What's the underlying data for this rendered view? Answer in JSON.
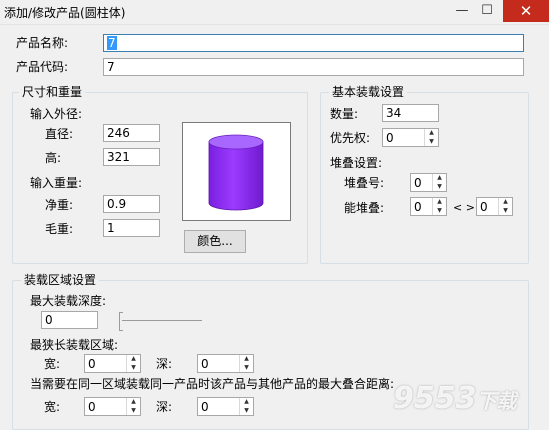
{
  "window": {
    "title": "添加/修改产品(圆柱体)",
    "minimize_glyph": "—",
    "maximize_glyph": "☐",
    "close_glyph": "✕"
  },
  "product": {
    "name_label": "产品名称:",
    "name_value": "7",
    "code_label": "产品代码:",
    "code_value": "7"
  },
  "size_weight": {
    "group_title": "尺寸和重量",
    "outer_label": "输入外径:",
    "diameter_label": "直径:",
    "diameter_value": "246",
    "height_label": "高:",
    "height_value": "321",
    "weight_label": "输入重量:",
    "net_label": "净重:",
    "net_value": "0.9",
    "gross_label": "毛重:",
    "gross_value": "1",
    "color_button": "颜色...",
    "preview_color": "#9b30ff"
  },
  "basic_loading": {
    "group_title": "基本装载设置",
    "quantity_label": "数量:",
    "quantity_value": "34",
    "priority_label": "优先权:",
    "priority_value": "0",
    "stack_label": "堆叠设置:",
    "stack_no_label": "堆叠号:",
    "stack_no_value": "0",
    "can_stack_label": "能堆叠:",
    "can_stack_value": "0",
    "separator": "< >",
    "can_stack_value2": "0"
  },
  "loading_area": {
    "group_title": "装载区域设置",
    "max_depth_label": "最大装载深度:",
    "max_depth_value": "0",
    "max_depth_level": 0,
    "narrow_label": "最狭长装载区域:",
    "width_label": "宽:",
    "width_value": "0",
    "depth_label": "深:",
    "depth_value": "0",
    "overlap_label": "当需要在同一区域装载同一产品时该产品与其他产品的最大叠合距离:",
    "overlap_width_label": "宽:",
    "overlap_width_value": "0",
    "overlap_depth_label": "深:",
    "overlap_depth_value": "0"
  },
  "watermark": {
    "text": "9553",
    "suffix": "下载"
  }
}
